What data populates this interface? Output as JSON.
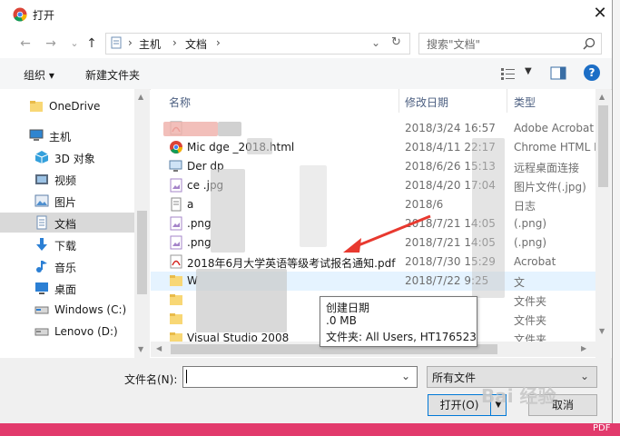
{
  "title_bar": {
    "title": "打开",
    "close_glyph": "✕"
  },
  "nav": {
    "back_glyph": "←",
    "forward_glyph": "→",
    "recent_glyph": "⌄",
    "up_glyph": "↑",
    "breadcrumb": [
      "主机",
      "文档"
    ],
    "refresh_glyph": "↻",
    "search_placeholder": "搜索\"文档\""
  },
  "toolbar": {
    "organize_label": "组织 ▾",
    "new_folder_label": "新建文件夹",
    "help_glyph": "?"
  },
  "sidebar": {
    "items": [
      {
        "label": "OneDrive",
        "icon": "folder-icon"
      },
      {
        "label": "主机",
        "icon": "computer-icon"
      },
      {
        "label": "3D 对象",
        "icon": "cube-icon"
      },
      {
        "label": "视频",
        "icon": "video-icon"
      },
      {
        "label": "图片",
        "icon": "picture-icon"
      },
      {
        "label": "文档",
        "icon": "document-icon"
      },
      {
        "label": "下载",
        "icon": "download-icon"
      },
      {
        "label": "音乐",
        "icon": "music-icon"
      },
      {
        "label": "桌面",
        "icon": "desktop-icon"
      },
      {
        "label": "Windows (C:)",
        "icon": "drive-icon"
      },
      {
        "label": "Lenovo (D:)",
        "icon": "drive-icon"
      }
    ],
    "selected_index": 5
  },
  "columns": {
    "name": "名称",
    "date": "修改日期",
    "type": "类型"
  },
  "files": [
    {
      "name": "",
      "date": "2018/3/24 16:57",
      "type": "Adobe Acrobat",
      "icon": "pdf-icon"
    },
    {
      "name": "Mic            dge      _2018.html",
      "date": "2018/4/11 22:17",
      "type": "Chrome HTML D",
      "icon": "chrome-icon"
    },
    {
      "name": "Der        dp",
      "date": "2018/6/26 15:13",
      "type": "远程桌面连接",
      "icon": "remote-desktop-icon"
    },
    {
      "name": "ce             .jpg",
      "date": "2018/4/20 17:04",
      "type": "图片文件(.jpg)",
      "icon": "image-icon"
    },
    {
      "name": "a",
      "date": "2018/6",
      "type": "日志",
      "icon": "text-file-icon"
    },
    {
      "name": "             .png",
      "date": "2018/7/21 14:05",
      "type": "(.png)",
      "icon": "image-icon"
    },
    {
      "name": "             .png",
      "date": "2018/7/21 14:05",
      "type": "(.png)",
      "icon": "image-icon"
    },
    {
      "name": "2018年6月大学英语等级考试报名通知.pdf",
      "date": "2018/7/30 15:29",
      "type": "Acrobat",
      "icon": "pdf-icon"
    },
    {
      "name": "W",
      "date": "2018/7/22 9:25",
      "type": "文",
      "icon": "folder-icon"
    },
    {
      "name": "",
      "date": "",
      "type": "文件夹",
      "icon": "folder-icon"
    },
    {
      "name": "",
      "date": "",
      "type": "文件夹",
      "icon": "folder-icon"
    },
    {
      "name": "Visual Studio 2008",
      "date": "",
      "type": "文件夹",
      "icon": "folder-icon"
    }
  ],
  "tooltip": {
    "line1": "创建日期",
    "line2": "      .0 MB",
    "line3": "文件夹: All Users, HT176523"
  },
  "bottom": {
    "filename_label": "文件名(N):",
    "filename_value": "",
    "filter_value": "所有文件",
    "open_label": "打开(O)",
    "cancel_label": "取消"
  },
  "watermark": "Bai 经验",
  "bg_tag": "PDF",
  "colors": {
    "accent": "#0078d7",
    "arrow": "#e8392f",
    "bg_strip": "#e23a6c"
  }
}
